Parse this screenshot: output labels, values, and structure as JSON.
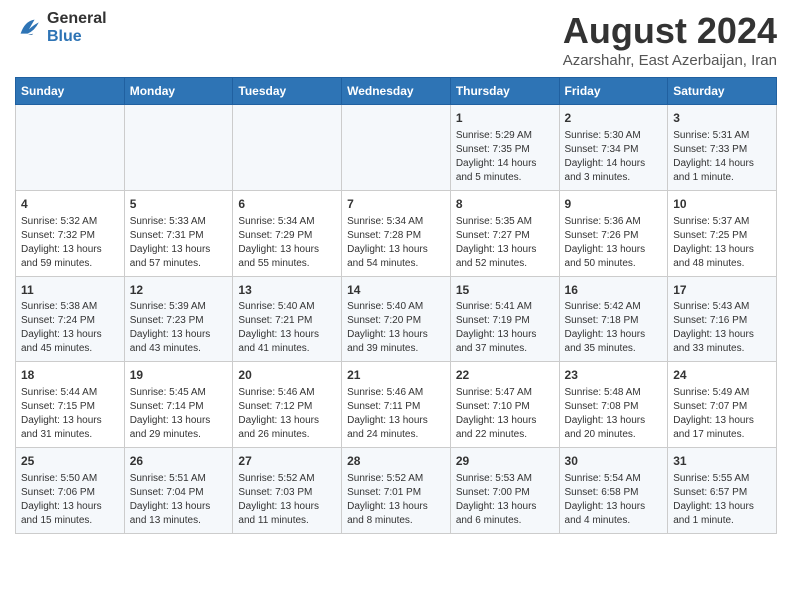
{
  "header": {
    "logo_line1": "General",
    "logo_line2": "Blue",
    "main_title": "August 2024",
    "subtitle": "Azarshahr, East Azerbaijan, Iran"
  },
  "days_of_week": [
    "Sunday",
    "Monday",
    "Tuesday",
    "Wednesday",
    "Thursday",
    "Friday",
    "Saturday"
  ],
  "weeks": [
    [
      {
        "day": "",
        "info": ""
      },
      {
        "day": "",
        "info": ""
      },
      {
        "day": "",
        "info": ""
      },
      {
        "day": "",
        "info": ""
      },
      {
        "day": "1",
        "info": "Sunrise: 5:29 AM\nSunset: 7:35 PM\nDaylight: 14 hours\nand 5 minutes."
      },
      {
        "day": "2",
        "info": "Sunrise: 5:30 AM\nSunset: 7:34 PM\nDaylight: 14 hours\nand 3 minutes."
      },
      {
        "day": "3",
        "info": "Sunrise: 5:31 AM\nSunset: 7:33 PM\nDaylight: 14 hours\nand 1 minute."
      }
    ],
    [
      {
        "day": "4",
        "info": "Sunrise: 5:32 AM\nSunset: 7:32 PM\nDaylight: 13 hours\nand 59 minutes."
      },
      {
        "day": "5",
        "info": "Sunrise: 5:33 AM\nSunset: 7:31 PM\nDaylight: 13 hours\nand 57 minutes."
      },
      {
        "day": "6",
        "info": "Sunrise: 5:34 AM\nSunset: 7:29 PM\nDaylight: 13 hours\nand 55 minutes."
      },
      {
        "day": "7",
        "info": "Sunrise: 5:34 AM\nSunset: 7:28 PM\nDaylight: 13 hours\nand 54 minutes."
      },
      {
        "day": "8",
        "info": "Sunrise: 5:35 AM\nSunset: 7:27 PM\nDaylight: 13 hours\nand 52 minutes."
      },
      {
        "day": "9",
        "info": "Sunrise: 5:36 AM\nSunset: 7:26 PM\nDaylight: 13 hours\nand 50 minutes."
      },
      {
        "day": "10",
        "info": "Sunrise: 5:37 AM\nSunset: 7:25 PM\nDaylight: 13 hours\nand 48 minutes."
      }
    ],
    [
      {
        "day": "11",
        "info": "Sunrise: 5:38 AM\nSunset: 7:24 PM\nDaylight: 13 hours\nand 45 minutes."
      },
      {
        "day": "12",
        "info": "Sunrise: 5:39 AM\nSunset: 7:23 PM\nDaylight: 13 hours\nand 43 minutes."
      },
      {
        "day": "13",
        "info": "Sunrise: 5:40 AM\nSunset: 7:21 PM\nDaylight: 13 hours\nand 41 minutes."
      },
      {
        "day": "14",
        "info": "Sunrise: 5:40 AM\nSunset: 7:20 PM\nDaylight: 13 hours\nand 39 minutes."
      },
      {
        "day": "15",
        "info": "Sunrise: 5:41 AM\nSunset: 7:19 PM\nDaylight: 13 hours\nand 37 minutes."
      },
      {
        "day": "16",
        "info": "Sunrise: 5:42 AM\nSunset: 7:18 PM\nDaylight: 13 hours\nand 35 minutes."
      },
      {
        "day": "17",
        "info": "Sunrise: 5:43 AM\nSunset: 7:16 PM\nDaylight: 13 hours\nand 33 minutes."
      }
    ],
    [
      {
        "day": "18",
        "info": "Sunrise: 5:44 AM\nSunset: 7:15 PM\nDaylight: 13 hours\nand 31 minutes."
      },
      {
        "day": "19",
        "info": "Sunrise: 5:45 AM\nSunset: 7:14 PM\nDaylight: 13 hours\nand 29 minutes."
      },
      {
        "day": "20",
        "info": "Sunrise: 5:46 AM\nSunset: 7:12 PM\nDaylight: 13 hours\nand 26 minutes."
      },
      {
        "day": "21",
        "info": "Sunrise: 5:46 AM\nSunset: 7:11 PM\nDaylight: 13 hours\nand 24 minutes."
      },
      {
        "day": "22",
        "info": "Sunrise: 5:47 AM\nSunset: 7:10 PM\nDaylight: 13 hours\nand 22 minutes."
      },
      {
        "day": "23",
        "info": "Sunrise: 5:48 AM\nSunset: 7:08 PM\nDaylight: 13 hours\nand 20 minutes."
      },
      {
        "day": "24",
        "info": "Sunrise: 5:49 AM\nSunset: 7:07 PM\nDaylight: 13 hours\nand 17 minutes."
      }
    ],
    [
      {
        "day": "25",
        "info": "Sunrise: 5:50 AM\nSunset: 7:06 PM\nDaylight: 13 hours\nand 15 minutes."
      },
      {
        "day": "26",
        "info": "Sunrise: 5:51 AM\nSunset: 7:04 PM\nDaylight: 13 hours\nand 13 minutes."
      },
      {
        "day": "27",
        "info": "Sunrise: 5:52 AM\nSunset: 7:03 PM\nDaylight: 13 hours\nand 11 minutes."
      },
      {
        "day": "28",
        "info": "Sunrise: 5:52 AM\nSunset: 7:01 PM\nDaylight: 13 hours\nand 8 minutes."
      },
      {
        "day": "29",
        "info": "Sunrise: 5:53 AM\nSunset: 7:00 PM\nDaylight: 13 hours\nand 6 minutes."
      },
      {
        "day": "30",
        "info": "Sunrise: 5:54 AM\nSunset: 6:58 PM\nDaylight: 13 hours\nand 4 minutes."
      },
      {
        "day": "31",
        "info": "Sunrise: 5:55 AM\nSunset: 6:57 PM\nDaylight: 13 hours\nand 1 minute."
      }
    ]
  ]
}
